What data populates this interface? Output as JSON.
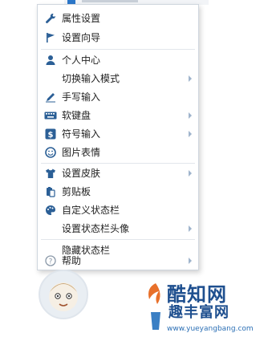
{
  "menu": {
    "items": [
      {
        "label": "属性设置",
        "icon": "wrench-icon",
        "submenu": false
      },
      {
        "label": "设置向导",
        "icon": "flag-icon",
        "submenu": false
      },
      {
        "label": "个人中心",
        "icon": "person-icon",
        "submenu": false
      },
      {
        "label": "切换输入模式",
        "icon": "",
        "submenu": true
      },
      {
        "label": "手写输入",
        "icon": "pen-icon",
        "submenu": false
      },
      {
        "label": "软键盘",
        "icon": "keyboard-icon",
        "submenu": true
      },
      {
        "label": "符号输入",
        "icon": "dollar-icon",
        "submenu": true
      },
      {
        "label": "图片表情",
        "icon": "smiley-icon",
        "submenu": false
      },
      {
        "label": "设置皮肤",
        "icon": "tshirt-icon",
        "submenu": true
      },
      {
        "label": "剪贴板",
        "icon": "clipboard-icon",
        "submenu": false
      },
      {
        "label": "自定义状态栏",
        "icon": "palette-icon",
        "submenu": false
      },
      {
        "label": "设置状态栏头像",
        "icon": "",
        "submenu": true
      },
      {
        "label": "隐藏状态栏",
        "icon": "",
        "submenu": false
      },
      {
        "label": "帮助",
        "icon": "help-icon",
        "submenu": true
      }
    ]
  },
  "watermark": {
    "name": "酷知网",
    "name2": "趣丰富网",
    "url": "www.yueyangbang.com"
  },
  "colors": {
    "icon": "#2b5f96",
    "arrow": "#9fb4cc",
    "border": "#cfd6de"
  }
}
